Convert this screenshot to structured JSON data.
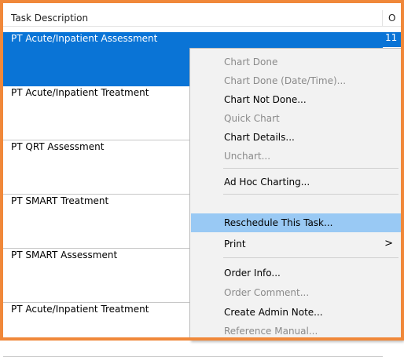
{
  "header": {
    "col1": "Task Description",
    "col2": "O"
  },
  "rows": [
    {
      "label": "PT Acute/Inpatient Assessment",
      "extra": "11"
    },
    {
      "label": "PT Acute/Inpatient Treatment"
    },
    {
      "label": "PT QRT Assessment"
    },
    {
      "label": "PT SMART Treatment"
    },
    {
      "label": "PT SMART Assessment"
    },
    {
      "label": "PT Acute/Inpatient Treatment"
    }
  ],
  "menu": {
    "items": [
      {
        "label": "Chart Done",
        "enabled": false
      },
      {
        "label": "Chart Done (Date/Time)...",
        "enabled": false
      },
      {
        "label": "Chart Not Done...",
        "enabled": true
      },
      {
        "label": "Quick Chart",
        "enabled": false
      },
      {
        "label": "Chart Details...",
        "enabled": true
      },
      {
        "label": "Unchart...",
        "enabled": false
      },
      {
        "label": "Ad Hoc Charting...",
        "enabled": true
      },
      {
        "label": "Reschedule This Task...",
        "enabled": true,
        "highlighted": true
      },
      {
        "label": "Print",
        "enabled": true,
        "submenu_arrow": ">"
      },
      {
        "label": "Order Info...",
        "enabled": true
      },
      {
        "label": "Order Comment...",
        "enabled": false
      },
      {
        "label": "Create Admin Note...",
        "enabled": true
      },
      {
        "label": "Reference Manual...",
        "enabled": false
      }
    ]
  },
  "colors": {
    "selection": "#0a74d6",
    "menu_highlight": "#99c9f4",
    "frame": "#f0883a"
  }
}
